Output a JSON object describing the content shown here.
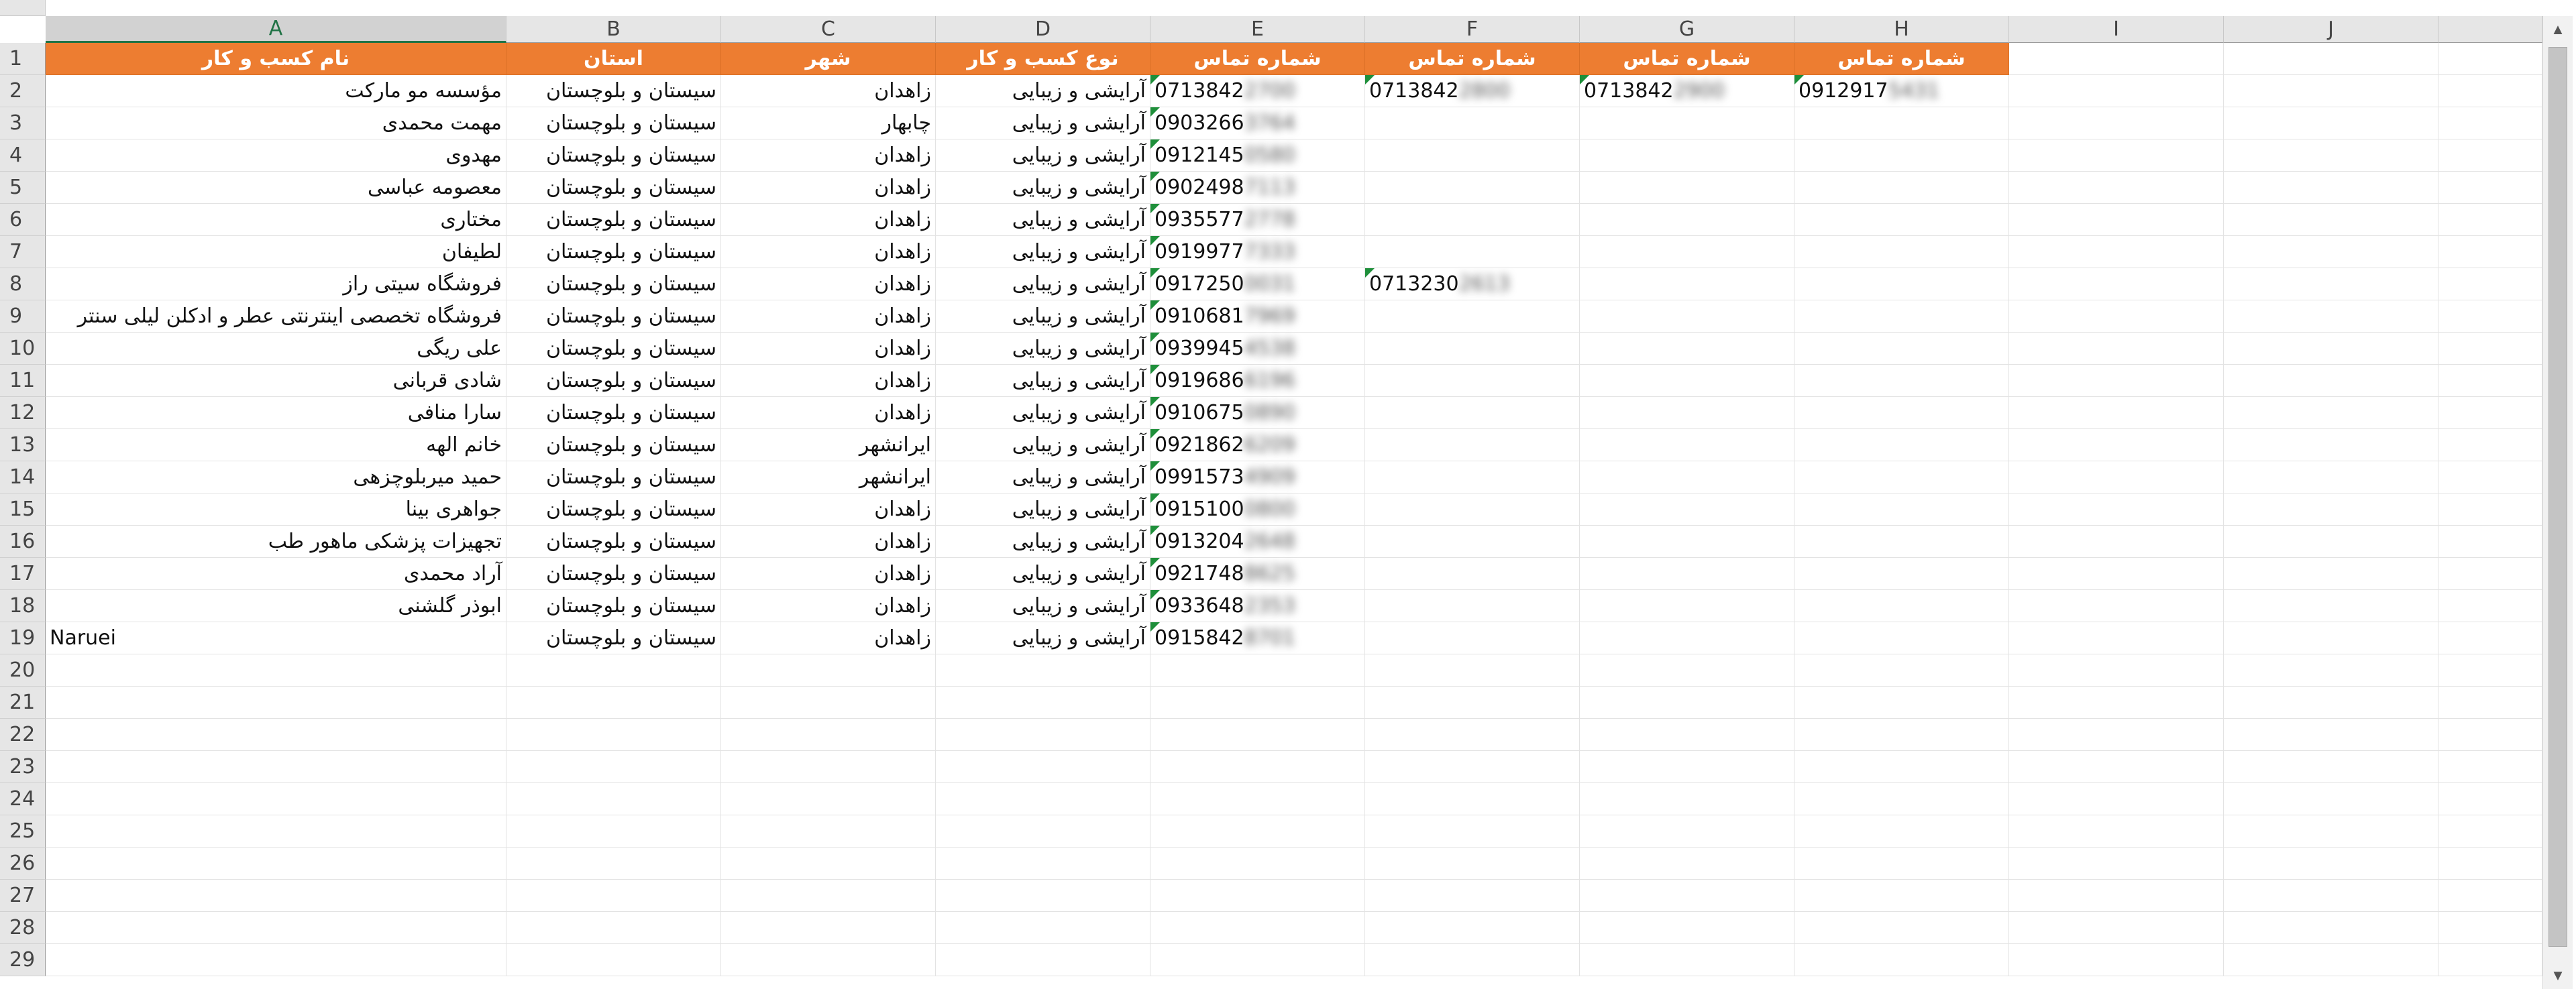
{
  "sheet": {
    "columns": [
      "A",
      "B",
      "C",
      "D",
      "E",
      "F",
      "G",
      "H",
      "I",
      "J",
      ""
    ],
    "selected_column": "A",
    "row_numbers": [
      "1",
      "2",
      "3",
      "4",
      "5",
      "6",
      "7",
      "8",
      "9",
      "10",
      "11",
      "12",
      "13",
      "14",
      "15",
      "16",
      "17",
      "18",
      "19",
      "20",
      "21",
      "22",
      "23",
      "24",
      "25",
      "26",
      "27",
      "28",
      "29"
    ],
    "header_row": [
      "نام کسب و کار",
      "استان",
      "شهر",
      "نوع کسب و کار",
      "شماره تماس",
      "شماره تماس",
      "شماره تماس",
      "شماره تماس"
    ],
    "header_color": "#ed7d31",
    "rows": [
      {
        "name": "مؤسسه مو مارکت",
        "province": "سیستان و بلوچستان",
        "city": "زاهدان",
        "type": "آرایشی و زیبایی",
        "phone1": "0713842",
        "phone1_hidden": "2700",
        "phone2": "0713842",
        "phone2_hidden": "2800",
        "phone3": "0713842",
        "phone3_hidden": "2900",
        "phone4": "0912917",
        "phone4_hidden": "5431"
      },
      {
        "name": "مهمت محمدی",
        "province": "سیستان و بلوچستان",
        "city": "چابهار",
        "type": "آرایشی و زیبایی",
        "phone1": "0903266",
        "phone1_hidden": "3764"
      },
      {
        "name": "مهدوی",
        "province": "سیستان و بلوچستان",
        "city": "زاهدان",
        "type": "آرایشی و زیبایی",
        "phone1": "0912145",
        "phone1_hidden": "0580"
      },
      {
        "name": "معصومه عباسی",
        "province": "سیستان و بلوچستان",
        "city": "زاهدان",
        "type": "آرایشی و زیبایی",
        "phone1": "0902498",
        "phone1_hidden": "7113"
      },
      {
        "name": "مختاری",
        "province": "سیستان و بلوچستان",
        "city": "زاهدان",
        "type": "آرایشی و زیبایی",
        "phone1": "0935577",
        "phone1_hidden": "2778"
      },
      {
        "name": "لطیفان",
        "province": "سیستان و بلوچستان",
        "city": "زاهدان",
        "type": "آرایشی و زیبایی",
        "phone1": "0919977",
        "phone1_hidden": "7333"
      },
      {
        "name": "فروشگاه سیتی راز",
        "province": "سیستان و بلوچستان",
        "city": "زاهدان",
        "type": "آرایشی و زیبایی",
        "phone1": "0917250",
        "phone1_hidden": "0031",
        "phone2": "0713230",
        "phone2_hidden": "2613"
      },
      {
        "name": "فروشگاه تخصصی اینترنتی عطر و ادکلن لیلی سنتر",
        "province": "سیستان و بلوچستان",
        "city": "زاهدان",
        "type": "آرایشی و زیبایی",
        "phone1": "0910681",
        "phone1_hidden": "7969"
      },
      {
        "name": "علی ریگی",
        "province": "سیستان و بلوچستان",
        "city": "زاهدان",
        "type": "آرایشی و زیبایی",
        "phone1": "0939945",
        "phone1_hidden": "4538"
      },
      {
        "name": "شادی قربانی",
        "province": "سیستان و بلوچستان",
        "city": "زاهدان",
        "type": "آرایشی و زیبایی",
        "phone1": "0919686",
        "phone1_hidden": "6196"
      },
      {
        "name": "سارا منافی",
        "province": "سیستان و بلوچستان",
        "city": "زاهدان",
        "type": "آرایشی و زیبایی",
        "phone1": "0910675",
        "phone1_hidden": "0890"
      },
      {
        "name": "خانم الهه",
        "province": "سیستان و بلوچستان",
        "city": "ایرانشهر",
        "type": "آرایشی و زیبایی",
        "phone1": "0921862",
        "phone1_hidden": "6209"
      },
      {
        "name": "حمید میربلوچزهی",
        "province": "سیستان و بلوچستان",
        "city": "ایرانشهر",
        "type": "آرایشی و زیبایی",
        "phone1": "0991573",
        "phone1_hidden": "4909"
      },
      {
        "name": "جواهری بینا",
        "province": "سیستان و بلوچستان",
        "city": "زاهدان",
        "type": "آرایشی و زیبایی",
        "phone1": "0915100",
        "phone1_hidden": "0800"
      },
      {
        "name": "تجهیزات پزشکی ماهور طب",
        "province": "سیستان و بلوچستان",
        "city": "زاهدان",
        "type": "آرایشی و زیبایی",
        "phone1": "0913204",
        "phone1_hidden": "2648"
      },
      {
        "name": "آراد محمدی",
        "province": "سیستان و بلوچستان",
        "city": "زاهدان",
        "type": "آرایشی و زیبایی",
        "phone1": "0921748",
        "phone1_hidden": "8625"
      },
      {
        "name": "ابوذر گلشنی",
        "province": "سیستان و بلوچستان",
        "city": "زاهدان",
        "type": "آرایشی و زیبایی",
        "phone1": "0933648",
        "phone1_hidden": "2353"
      },
      {
        "name": "Naruei",
        "province": "سیستان و بلوچستان",
        "city": "زاهدان",
        "type": "آرایشی و زیبایی",
        "phone1": "0915842",
        "phone1_hidden": "8701"
      }
    ]
  }
}
